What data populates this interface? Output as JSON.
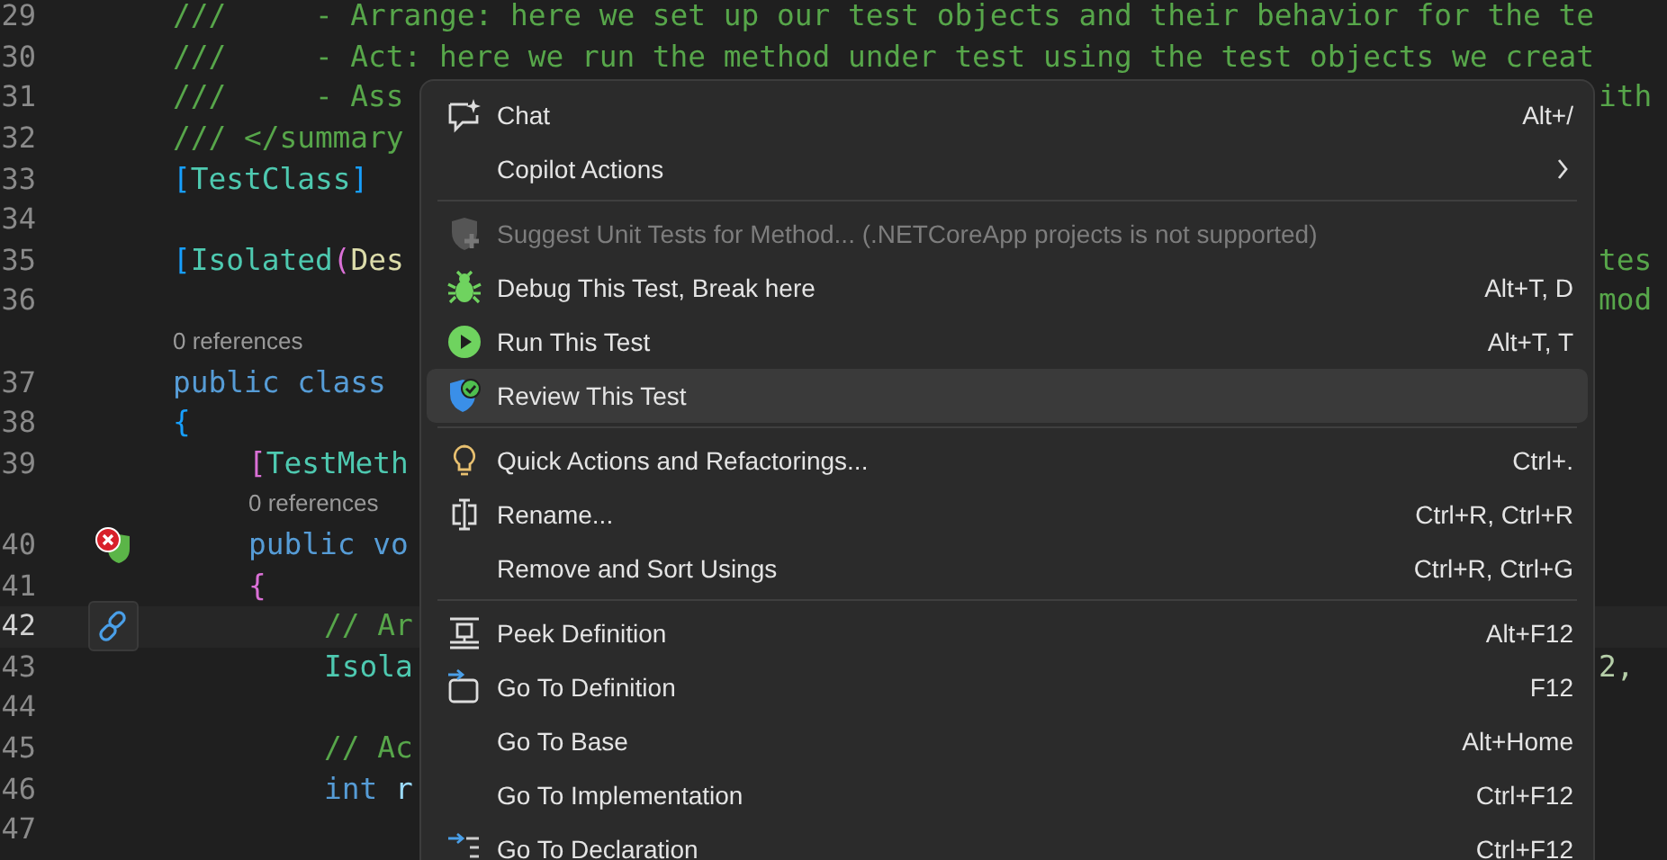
{
  "editor": {
    "lines": [
      {
        "kind": "code",
        "number": "29",
        "tokens": [
          {
            "text": "///     - Arrange: here we set up our test objects and their behavior for the te",
            "kind": "comment"
          }
        ]
      },
      {
        "kind": "code",
        "number": "30",
        "tokens": [
          {
            "text": "///     - Act: here we run the method under test using the test objects we creat",
            "kind": "comment"
          }
        ]
      },
      {
        "kind": "code",
        "number": "31",
        "tokens": [
          {
            "text": "///     - Ass",
            "kind": "comment"
          }
        ],
        "right": {
          "text": "ith",
          "kind": "comment"
        }
      },
      {
        "kind": "code",
        "number": "32",
        "tokens": [
          {
            "text": "/// </summary",
            "kind": "comment"
          }
        ]
      },
      {
        "kind": "code",
        "number": "33",
        "tokens": [
          {
            "text": "[",
            "kind": "bracket"
          },
          {
            "text": "TestClass",
            "kind": "type"
          },
          {
            "text": "]",
            "kind": "bracket"
          }
        ]
      },
      {
        "kind": "code",
        "number": "34"
      },
      {
        "kind": "code",
        "number": "35",
        "tokens": [
          {
            "text": "[",
            "kind": "bracket"
          },
          {
            "text": "Isolated",
            "kind": "type"
          },
          {
            "text": "(",
            "kind": "bracket2"
          },
          {
            "text": "Des",
            "kind": "param"
          }
        ],
        "right": {
          "text": "tes",
          "kind": "comment"
        }
      },
      {
        "kind": "code",
        "number": "36",
        "right": {
          "text": "mod",
          "kind": "comment"
        }
      },
      {
        "kind": "codelens",
        "text": "0 references"
      },
      {
        "kind": "code",
        "number": "37",
        "tokens": [
          {
            "text": "public class ",
            "kind": "keyword"
          }
        ]
      },
      {
        "kind": "code",
        "number": "38",
        "tokens": [
          {
            "text": "{",
            "kind": "bracket"
          }
        ],
        "children": [
          {
            "kind": "code",
            "number": "39",
            "tokens": [
              {
                "text": "[",
                "kind": "bracket2"
              },
              {
                "text": "TestMeth",
                "kind": "type"
              }
            ]
          },
          {
            "kind": "codelens",
            "text": "0 references"
          },
          {
            "kind": "code",
            "number": "40",
            "test_failed": true,
            "tokens": [
              {
                "text": "public vo",
                "kind": "keyword"
              }
            ]
          },
          {
            "kind": "code",
            "number": "41",
            "tokens": [
              {
                "text": "{",
                "kind": "bracket2"
              }
            ],
            "children": [
              {
                "kind": "code",
                "number": "42",
                "current": true,
                "quick_actions": true,
                "tokens": [
                  {
                    "text": "// Ar",
                    "kind": "comment"
                  }
                ]
              },
              {
                "kind": "code",
                "number": "43",
                "tokens": [
                  {
                    "text": "Isola",
                    "kind": "type"
                  }
                ],
                "right": {
                  "text": "2,",
                  "kind": "number"
                }
              },
              {
                "kind": "code",
                "number": "44"
              },
              {
                "kind": "code",
                "number": "45",
                "tokens": [
                  {
                    "text": "// Ac",
                    "kind": "comment"
                  }
                ]
              },
              {
                "kind": "code",
                "number": "46",
                "tokens": [
                  {
                    "text": "int",
                    "kind": "keyword"
                  },
                  {
                    "text": " r",
                    "kind": "variable"
                  }
                ]
              },
              {
                "kind": "code",
                "number": "47"
              }
            ]
          }
        ]
      }
    ]
  },
  "context_menu": {
    "items": [
      {
        "kind": "item",
        "label": "Chat",
        "shortcut": "Alt+/",
        "disabled": false,
        "selected": false,
        "submenu": false
      },
      {
        "kind": "item",
        "label": "Copilot Actions",
        "disabled": false,
        "selected": false,
        "submenu": true
      },
      {
        "kind": "separator"
      },
      {
        "kind": "item",
        "label": "Suggest Unit Tests for Method... (.NETCoreApp projects is not supported)",
        "disabled": true,
        "selected": false,
        "submenu": false
      },
      {
        "kind": "item",
        "label": "Debug This Test, Break here",
        "shortcut": "Alt+T, D",
        "disabled": false,
        "selected": false,
        "submenu": false
      },
      {
        "kind": "item",
        "label": "Run This Test",
        "shortcut": "Alt+T, T",
        "disabled": false,
        "selected": false,
        "submenu": false
      },
      {
        "kind": "item",
        "label": "Review This Test",
        "disabled": false,
        "selected": true,
        "submenu": false
      },
      {
        "kind": "separator"
      },
      {
        "kind": "item",
        "label": "Quick Actions and Refactorings...",
        "shortcut": "Ctrl+.",
        "disabled": false,
        "selected": false,
        "submenu": false
      },
      {
        "kind": "item",
        "label": "Rename...",
        "shortcut": "Ctrl+R, Ctrl+R",
        "disabled": false,
        "selected": false,
        "submenu": false
      },
      {
        "kind": "item",
        "label": "Remove and Sort Usings",
        "shortcut": "Ctrl+R, Ctrl+G",
        "disabled": false,
        "selected": false,
        "submenu": false
      },
      {
        "kind": "separator"
      },
      {
        "kind": "item",
        "label": "Peek Definition",
        "shortcut": "Alt+F12",
        "disabled": false,
        "selected": false,
        "submenu": false
      },
      {
        "kind": "item",
        "label": "Go To Definition",
        "shortcut": "F12",
        "disabled": false,
        "selected": false,
        "submenu": false
      },
      {
        "kind": "item",
        "label": "Go To Base",
        "shortcut": "Alt+Home",
        "disabled": false,
        "selected": false,
        "submenu": false
      },
      {
        "kind": "item",
        "label": "Go To Implementation",
        "shortcut": "Ctrl+F12",
        "disabled": false,
        "selected": false,
        "submenu": false
      },
      {
        "kind": "item",
        "label": "Go To Declaration",
        "shortcut": "Ctrl+F12",
        "disabled": false,
        "selected": false,
        "submenu": false
      }
    ]
  }
}
